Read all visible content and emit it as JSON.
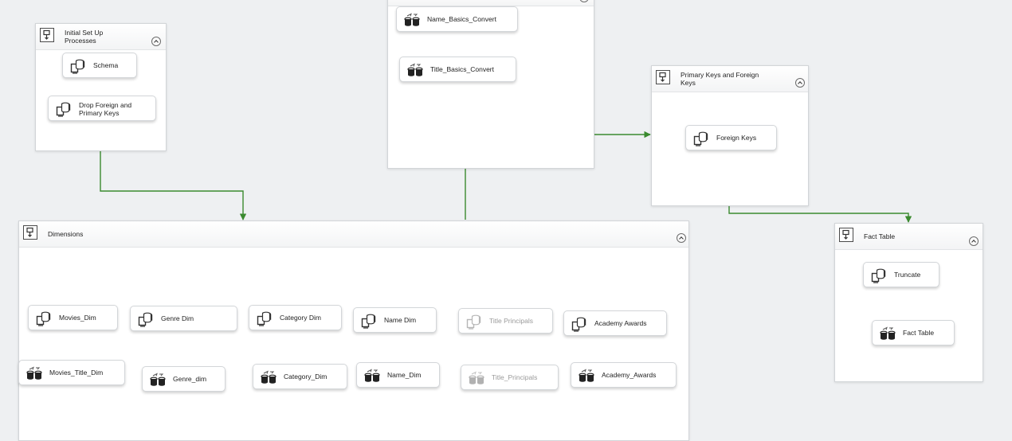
{
  "colors": {
    "canvas_background": "#eef0f2",
    "precedence_constraint": "#3a8a2f",
    "disabled_text": "#9a9a9a"
  },
  "containers": {
    "initial_setup": {
      "title": "Initial Set Up Processes",
      "icon": "sequence-container-icon"
    },
    "convert": {
      "title": "",
      "icon": "sequence-container-icon"
    },
    "primary_foreign": {
      "title": "Primary Keys and Foreign Keys",
      "icon": "sequence-container-icon"
    },
    "dimensions": {
      "title": "Dimensions",
      "icon": "sequence-container-icon"
    },
    "fact_table": {
      "title": "Fact Table",
      "icon": "sequence-container-icon"
    }
  },
  "tasks": {
    "schema": {
      "label": "Schema",
      "icon": "execute-sql-task-icon",
      "enabled": true
    },
    "drop_keys": {
      "label": "Drop Foreign and Primary Keys",
      "icon": "execute-sql-task-icon",
      "enabled": true
    },
    "name_basics_convert": {
      "label": "Name_Basics_Convert",
      "icon": "data-flow-task-icon",
      "enabled": false
    },
    "title_basics_convert": {
      "label": "Title_Basics_Convert",
      "icon": "data-flow-task-icon",
      "enabled": false
    },
    "foreign_keys": {
      "label": "Foreign Keys",
      "icon": "execute-sql-task-icon",
      "enabled": true
    },
    "movies_dim": {
      "label": "Movies_Dim",
      "icon": "execute-sql-task-icon",
      "enabled": true
    },
    "movies_title_dim": {
      "label": "Movies_Title_Dim",
      "icon": "data-flow-task-icon",
      "enabled": true
    },
    "genre_dim_sql": {
      "label": "Genre Dim",
      "icon": "execute-sql-task-icon",
      "enabled": true
    },
    "genre_dim_df": {
      "label": "Genre_dim",
      "icon": "data-flow-task-icon",
      "enabled": true
    },
    "category_dim_sql": {
      "label": "Category Dim",
      "icon": "execute-sql-task-icon",
      "enabled": true
    },
    "category_dim_df": {
      "label": "Category_Dim",
      "icon": "data-flow-task-icon",
      "enabled": true
    },
    "name_dim_sql": {
      "label": "Name Dim",
      "icon": "execute-sql-task-icon",
      "enabled": true
    },
    "name_dim_df": {
      "label": "Name_Dim",
      "icon": "data-flow-task-icon",
      "enabled": true
    },
    "title_principals_sql": {
      "label": "Title Principals",
      "icon": "execute-sql-task-icon",
      "enabled": false
    },
    "title_principals_df": {
      "label": "Title_Principals",
      "icon": "data-flow-task-icon",
      "enabled": false
    },
    "academy_awards_sql": {
      "label": "Academy Awards",
      "icon": "execute-sql-task-icon",
      "enabled": true
    },
    "academy_awards_df": {
      "label": "Academy_Awards",
      "icon": "data-flow-task-icon",
      "enabled": true
    },
    "truncate": {
      "label": "Truncate",
      "icon": "execute-sql-task-icon",
      "enabled": true
    },
    "fact_table": {
      "label": "Fact Table",
      "icon": "data-flow-task-icon",
      "enabled": true
    }
  }
}
